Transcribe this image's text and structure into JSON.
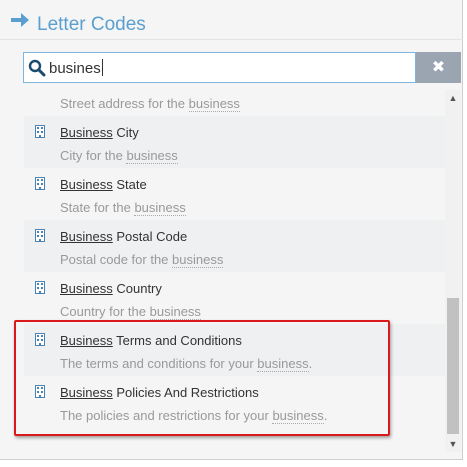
{
  "header": {
    "title": "Letter Codes"
  },
  "search": {
    "value": "busines"
  },
  "list": {
    "items": [
      {
        "name_match": "",
        "name_rest": "",
        "desc_prefix": "Street address for the ",
        "desc_match": "business",
        "desc_suffix": ""
      },
      {
        "name_match": "Business",
        "name_rest": " City",
        "desc_prefix": "City for the ",
        "desc_match": "business",
        "desc_suffix": ""
      },
      {
        "name_match": "Business",
        "name_rest": " State",
        "desc_prefix": "State for the ",
        "desc_match": "business",
        "desc_suffix": ""
      },
      {
        "name_match": "Business",
        "name_rest": " Postal Code",
        "desc_prefix": "Postal code for the ",
        "desc_match": "business",
        "desc_suffix": ""
      },
      {
        "name_match": "Business",
        "name_rest": " Country",
        "desc_prefix": "Country for the ",
        "desc_match": "business",
        "desc_suffix": ""
      },
      {
        "name_match": "Business",
        "name_rest": " Terms and Conditions",
        "desc_prefix": "The terms and conditions for your ",
        "desc_match": "business",
        "desc_suffix": "."
      },
      {
        "name_match": "Business",
        "name_rest": " Policies And Restrictions",
        "desc_prefix": "The policies and restrictions for your ",
        "desc_match": "business",
        "desc_suffix": "."
      }
    ]
  },
  "icons": {
    "header": "arrow-right-icon",
    "search": "search-icon",
    "clear": "close-icon",
    "item": "building-icon",
    "scroll_up": "chevron-up-icon",
    "scroll_down": "chevron-down-icon"
  },
  "colors": {
    "accent": "#5a9fcf",
    "highlight_border": "#d9191c",
    "clear_button": "#9aa5b1"
  }
}
